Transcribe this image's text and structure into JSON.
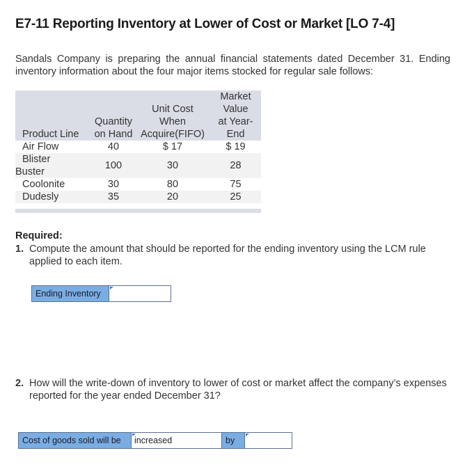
{
  "header": {
    "title": "E7-11 Reporting Inventory at Lower of Cost or Market [LO 7-4]"
  },
  "intro": "Sandals Company is preparing the annual financial statements dated December 31. Ending inventory information about the four major items stocked for regular sale follows:",
  "table": {
    "headers": {
      "product_line": "Product Line",
      "quantity": [
        "Quantity",
        "on Hand"
      ],
      "unit_cost": [
        "Unit Cost",
        "When",
        "Acquire(FIFO)"
      ],
      "market_value": [
        "Market",
        "Value",
        "at Year-",
        "End"
      ]
    },
    "rows": [
      {
        "product_line": "Air Flow",
        "quantity": "40",
        "unit_cost": "$ 17",
        "market_value": "$ 19"
      },
      {
        "product_line_lines": [
          "Blister",
          "Buster"
        ],
        "quantity": "100",
        "unit_cost": "30",
        "market_value": "28"
      },
      {
        "product_line": "Coolonite",
        "quantity": "30",
        "unit_cost": "80",
        "market_value": "75"
      },
      {
        "product_line": "Dudesly",
        "quantity": "35",
        "unit_cost": "20",
        "market_value": "25"
      }
    ]
  },
  "required": {
    "label": "Required:",
    "q1": {
      "number": "1.",
      "text": "Compute the amount that should be reported for the ending inventory using the LCM rule applied to each item.",
      "answer_label": "Ending Inventory",
      "answer_value": ""
    },
    "q2": {
      "number": "2.",
      "text": "How will the write-down of inventory to lower of cost or market affect the company’s expenses reported for the year ended December 31?",
      "answer_label": "Cost of goods sold will be",
      "answer_select_value": "increased",
      "answer_by_label": "by",
      "answer_amount_value": ""
    }
  }
}
